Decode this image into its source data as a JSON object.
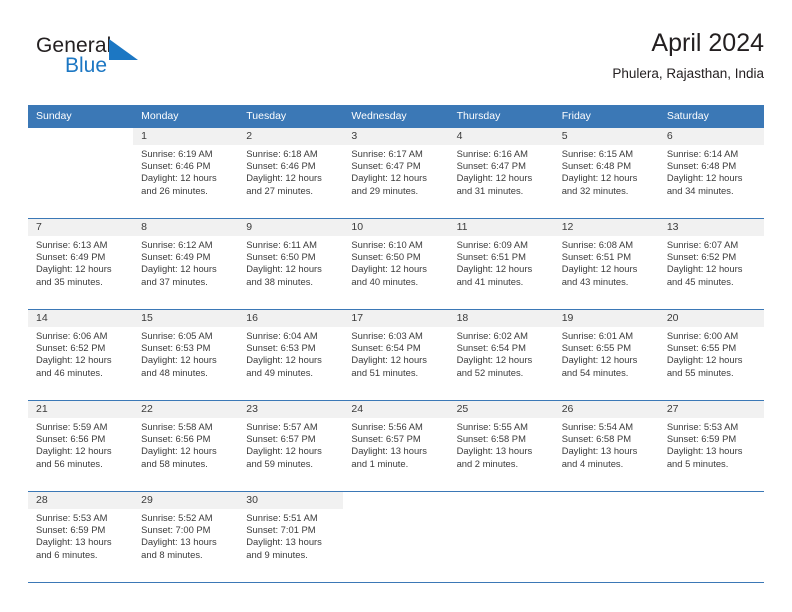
{
  "logo": {
    "word_one": "General",
    "word_two": "Blue",
    "triangle_icon": "triangle-icon",
    "accent_color": "#1c77c3"
  },
  "header": {
    "title": "April 2024",
    "subtitle": "Phulera, Rajasthan, India"
  },
  "calendar": {
    "header_bg": "#3b78b6",
    "daynum_bg": "#f1f1f1",
    "day_names": [
      "Sunday",
      "Monday",
      "Tuesday",
      "Wednesday",
      "Thursday",
      "Friday",
      "Saturday"
    ],
    "weeks": [
      [
        {
          "day": "",
          "sunrise": "",
          "sunset": "",
          "daylight_1": "",
          "daylight_2": ""
        },
        {
          "day": "1",
          "sunrise": "Sunrise: 6:19 AM",
          "sunset": "Sunset: 6:46 PM",
          "daylight_1": "Daylight: 12 hours",
          "daylight_2": "and 26 minutes."
        },
        {
          "day": "2",
          "sunrise": "Sunrise: 6:18 AM",
          "sunset": "Sunset: 6:46 PM",
          "daylight_1": "Daylight: 12 hours",
          "daylight_2": "and 27 minutes."
        },
        {
          "day": "3",
          "sunrise": "Sunrise: 6:17 AM",
          "sunset": "Sunset: 6:47 PM",
          "daylight_1": "Daylight: 12 hours",
          "daylight_2": "and 29 minutes."
        },
        {
          "day": "4",
          "sunrise": "Sunrise: 6:16 AM",
          "sunset": "Sunset: 6:47 PM",
          "daylight_1": "Daylight: 12 hours",
          "daylight_2": "and 31 minutes."
        },
        {
          "day": "5",
          "sunrise": "Sunrise: 6:15 AM",
          "sunset": "Sunset: 6:48 PM",
          "daylight_1": "Daylight: 12 hours",
          "daylight_2": "and 32 minutes."
        },
        {
          "day": "6",
          "sunrise": "Sunrise: 6:14 AM",
          "sunset": "Sunset: 6:48 PM",
          "daylight_1": "Daylight: 12 hours",
          "daylight_2": "and 34 minutes."
        }
      ],
      [
        {
          "day": "7",
          "sunrise": "Sunrise: 6:13 AM",
          "sunset": "Sunset: 6:49 PM",
          "daylight_1": "Daylight: 12 hours",
          "daylight_2": "and 35 minutes."
        },
        {
          "day": "8",
          "sunrise": "Sunrise: 6:12 AM",
          "sunset": "Sunset: 6:49 PM",
          "daylight_1": "Daylight: 12 hours",
          "daylight_2": "and 37 minutes."
        },
        {
          "day": "9",
          "sunrise": "Sunrise: 6:11 AM",
          "sunset": "Sunset: 6:50 PM",
          "daylight_1": "Daylight: 12 hours",
          "daylight_2": "and 38 minutes."
        },
        {
          "day": "10",
          "sunrise": "Sunrise: 6:10 AM",
          "sunset": "Sunset: 6:50 PM",
          "daylight_1": "Daylight: 12 hours",
          "daylight_2": "and 40 minutes."
        },
        {
          "day": "11",
          "sunrise": "Sunrise: 6:09 AM",
          "sunset": "Sunset: 6:51 PM",
          "daylight_1": "Daylight: 12 hours",
          "daylight_2": "and 41 minutes."
        },
        {
          "day": "12",
          "sunrise": "Sunrise: 6:08 AM",
          "sunset": "Sunset: 6:51 PM",
          "daylight_1": "Daylight: 12 hours",
          "daylight_2": "and 43 minutes."
        },
        {
          "day": "13",
          "sunrise": "Sunrise: 6:07 AM",
          "sunset": "Sunset: 6:52 PM",
          "daylight_1": "Daylight: 12 hours",
          "daylight_2": "and 45 minutes."
        }
      ],
      [
        {
          "day": "14",
          "sunrise": "Sunrise: 6:06 AM",
          "sunset": "Sunset: 6:52 PM",
          "daylight_1": "Daylight: 12 hours",
          "daylight_2": "and 46 minutes."
        },
        {
          "day": "15",
          "sunrise": "Sunrise: 6:05 AM",
          "sunset": "Sunset: 6:53 PM",
          "daylight_1": "Daylight: 12 hours",
          "daylight_2": "and 48 minutes."
        },
        {
          "day": "16",
          "sunrise": "Sunrise: 6:04 AM",
          "sunset": "Sunset: 6:53 PM",
          "daylight_1": "Daylight: 12 hours",
          "daylight_2": "and 49 minutes."
        },
        {
          "day": "17",
          "sunrise": "Sunrise: 6:03 AM",
          "sunset": "Sunset: 6:54 PM",
          "daylight_1": "Daylight: 12 hours",
          "daylight_2": "and 51 minutes."
        },
        {
          "day": "18",
          "sunrise": "Sunrise: 6:02 AM",
          "sunset": "Sunset: 6:54 PM",
          "daylight_1": "Daylight: 12 hours",
          "daylight_2": "and 52 minutes."
        },
        {
          "day": "19",
          "sunrise": "Sunrise: 6:01 AM",
          "sunset": "Sunset: 6:55 PM",
          "daylight_1": "Daylight: 12 hours",
          "daylight_2": "and 54 minutes."
        },
        {
          "day": "20",
          "sunrise": "Sunrise: 6:00 AM",
          "sunset": "Sunset: 6:55 PM",
          "daylight_1": "Daylight: 12 hours",
          "daylight_2": "and 55 minutes."
        }
      ],
      [
        {
          "day": "21",
          "sunrise": "Sunrise: 5:59 AM",
          "sunset": "Sunset: 6:56 PM",
          "daylight_1": "Daylight: 12 hours",
          "daylight_2": "and 56 minutes."
        },
        {
          "day": "22",
          "sunrise": "Sunrise: 5:58 AM",
          "sunset": "Sunset: 6:56 PM",
          "daylight_1": "Daylight: 12 hours",
          "daylight_2": "and 58 minutes."
        },
        {
          "day": "23",
          "sunrise": "Sunrise: 5:57 AM",
          "sunset": "Sunset: 6:57 PM",
          "daylight_1": "Daylight: 12 hours",
          "daylight_2": "and 59 minutes."
        },
        {
          "day": "24",
          "sunrise": "Sunrise: 5:56 AM",
          "sunset": "Sunset: 6:57 PM",
          "daylight_1": "Daylight: 13 hours",
          "daylight_2": "and 1 minute."
        },
        {
          "day": "25",
          "sunrise": "Sunrise: 5:55 AM",
          "sunset": "Sunset: 6:58 PM",
          "daylight_1": "Daylight: 13 hours",
          "daylight_2": "and 2 minutes."
        },
        {
          "day": "26",
          "sunrise": "Sunrise: 5:54 AM",
          "sunset": "Sunset: 6:58 PM",
          "daylight_1": "Daylight: 13 hours",
          "daylight_2": "and 4 minutes."
        },
        {
          "day": "27",
          "sunrise": "Sunrise: 5:53 AM",
          "sunset": "Sunset: 6:59 PM",
          "daylight_1": "Daylight: 13 hours",
          "daylight_2": "and 5 minutes."
        }
      ],
      [
        {
          "day": "28",
          "sunrise": "Sunrise: 5:53 AM",
          "sunset": "Sunset: 6:59 PM",
          "daylight_1": "Daylight: 13 hours",
          "daylight_2": "and 6 minutes."
        },
        {
          "day": "29",
          "sunrise": "Sunrise: 5:52 AM",
          "sunset": "Sunset: 7:00 PM",
          "daylight_1": "Daylight: 13 hours",
          "daylight_2": "and 8 minutes."
        },
        {
          "day": "30",
          "sunrise": "Sunrise: 5:51 AM",
          "sunset": "Sunset: 7:01 PM",
          "daylight_1": "Daylight: 13 hours",
          "daylight_2": "and 9 minutes."
        },
        {
          "day": "",
          "sunrise": "",
          "sunset": "",
          "daylight_1": "",
          "daylight_2": ""
        },
        {
          "day": "",
          "sunrise": "",
          "sunset": "",
          "daylight_1": "",
          "daylight_2": ""
        },
        {
          "day": "",
          "sunrise": "",
          "sunset": "",
          "daylight_1": "",
          "daylight_2": ""
        },
        {
          "day": "",
          "sunrise": "",
          "sunset": "",
          "daylight_1": "",
          "daylight_2": ""
        }
      ]
    ]
  }
}
